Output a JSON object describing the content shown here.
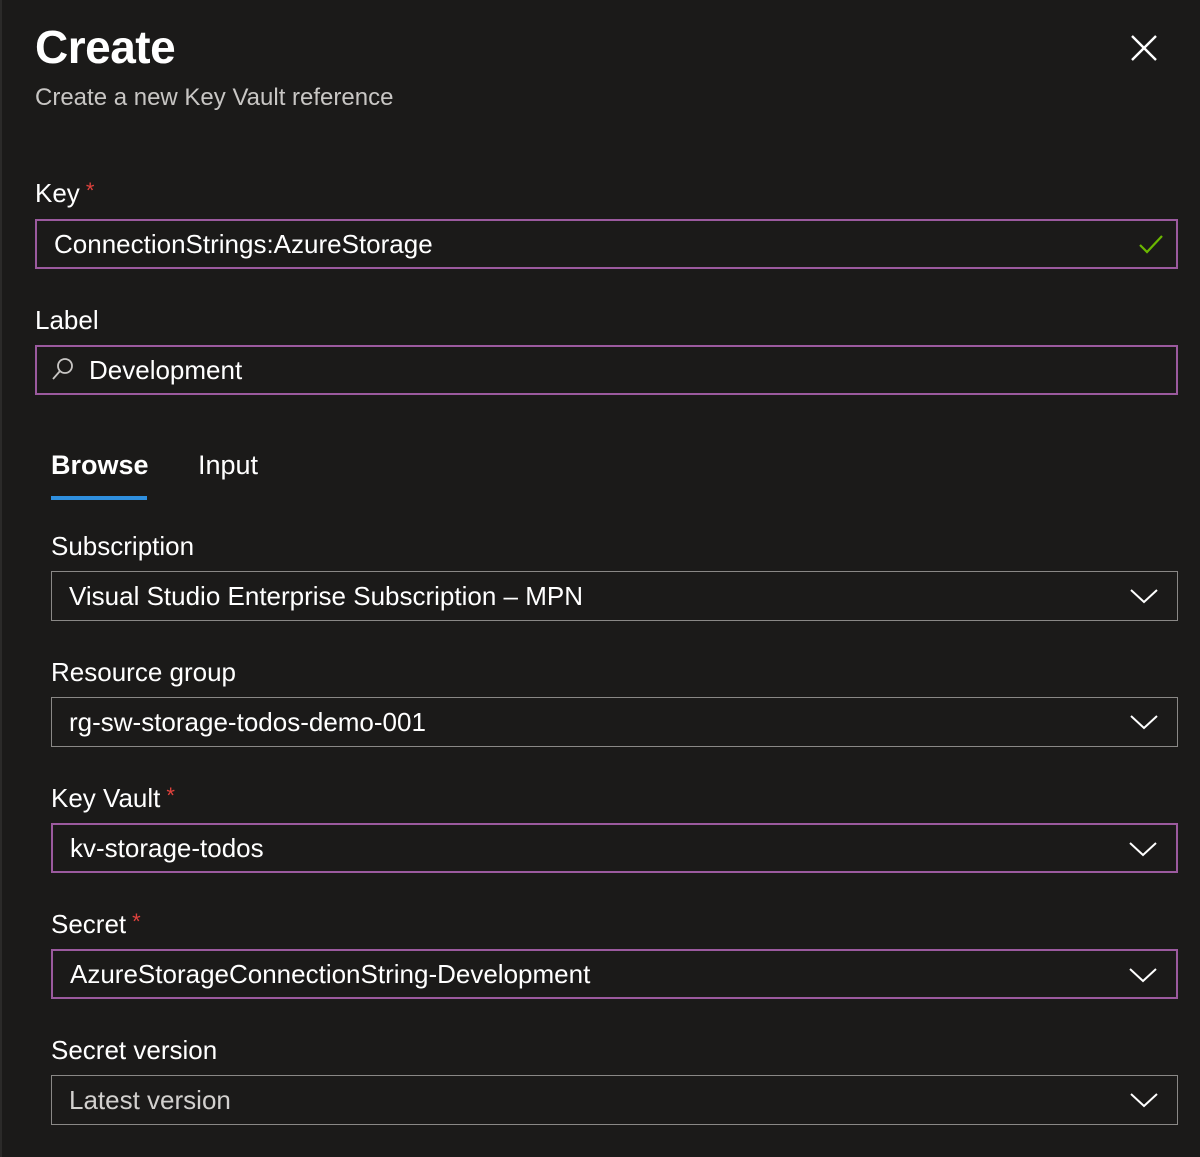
{
  "header": {
    "title": "Create",
    "subtitle": "Create a new Key Vault reference"
  },
  "key": {
    "label": "Key",
    "required_mark": "*",
    "value": "ConnectionStrings:AzureStorage"
  },
  "label_field": {
    "label": "Label",
    "value": "Development"
  },
  "tabs": [
    {
      "label": "Browse",
      "active": true
    },
    {
      "label": "Input",
      "active": false
    }
  ],
  "subscription": {
    "label": "Subscription",
    "value": "Visual Studio Enterprise Subscription – MPN"
  },
  "resource_group": {
    "label": "Resource group",
    "value": "rg-sw-storage-todos-demo-001"
  },
  "key_vault": {
    "label": "Key Vault",
    "required_mark": "*",
    "value": "kv-storage-todos"
  },
  "secret": {
    "label": "Secret",
    "required_mark": "*",
    "value": "AzureStorageConnectionString-Development"
  },
  "secret_version": {
    "label": "Secret version",
    "value": "Latest version"
  },
  "colors": {
    "background": "#1b1a19",
    "focus_border": "#9b5a9e",
    "tab_accent": "#2f8fde",
    "required": "#e0423d",
    "valid_check": "#6bb700"
  },
  "icons": {
    "close": "close-icon",
    "valid": "checkmark-icon",
    "search": "search-icon",
    "dropdown": "chevron-down-icon"
  }
}
